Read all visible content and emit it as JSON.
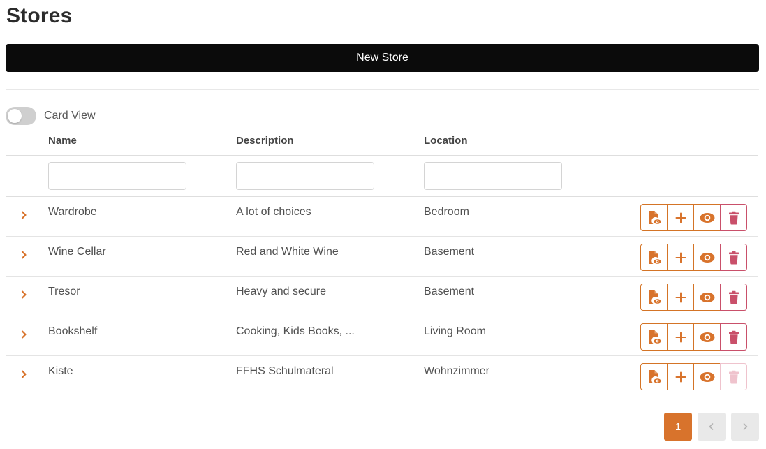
{
  "page": {
    "title": "Stores"
  },
  "toolbar": {
    "new_label": "New Store"
  },
  "view_toggle": {
    "label": "Card View",
    "on": false
  },
  "table": {
    "columns": [
      "Name",
      "Description",
      "Location"
    ],
    "rows": [
      {
        "name": "Wardrobe",
        "description": "A lot of choices",
        "location": "Bedroom",
        "delete_enabled": true
      },
      {
        "name": "Wine Cellar",
        "description": "Red and White Wine",
        "location": "Basement",
        "delete_enabled": true
      },
      {
        "name": "Tresor",
        "description": "Heavy and secure",
        "location": "Basement",
        "delete_enabled": true
      },
      {
        "name": "Bookshelf",
        "description": "Cooking, Kids Books, ...",
        "location": "Living Room",
        "delete_enabled": true
      },
      {
        "name": "Kiste",
        "description": "FFHS Schulmateral",
        "location": "Wohnzimmer",
        "delete_enabled": false
      }
    ],
    "row_actions": [
      "file-eye-icon",
      "plus-icon",
      "eye-icon",
      "trash-icon"
    ]
  },
  "pagination": {
    "current_page": "1"
  },
  "colors": {
    "accent": "#d8732c",
    "danger": "#c9506a",
    "danger_disabled": "#efc3cd",
    "primary_button": "#0b0b0b"
  }
}
